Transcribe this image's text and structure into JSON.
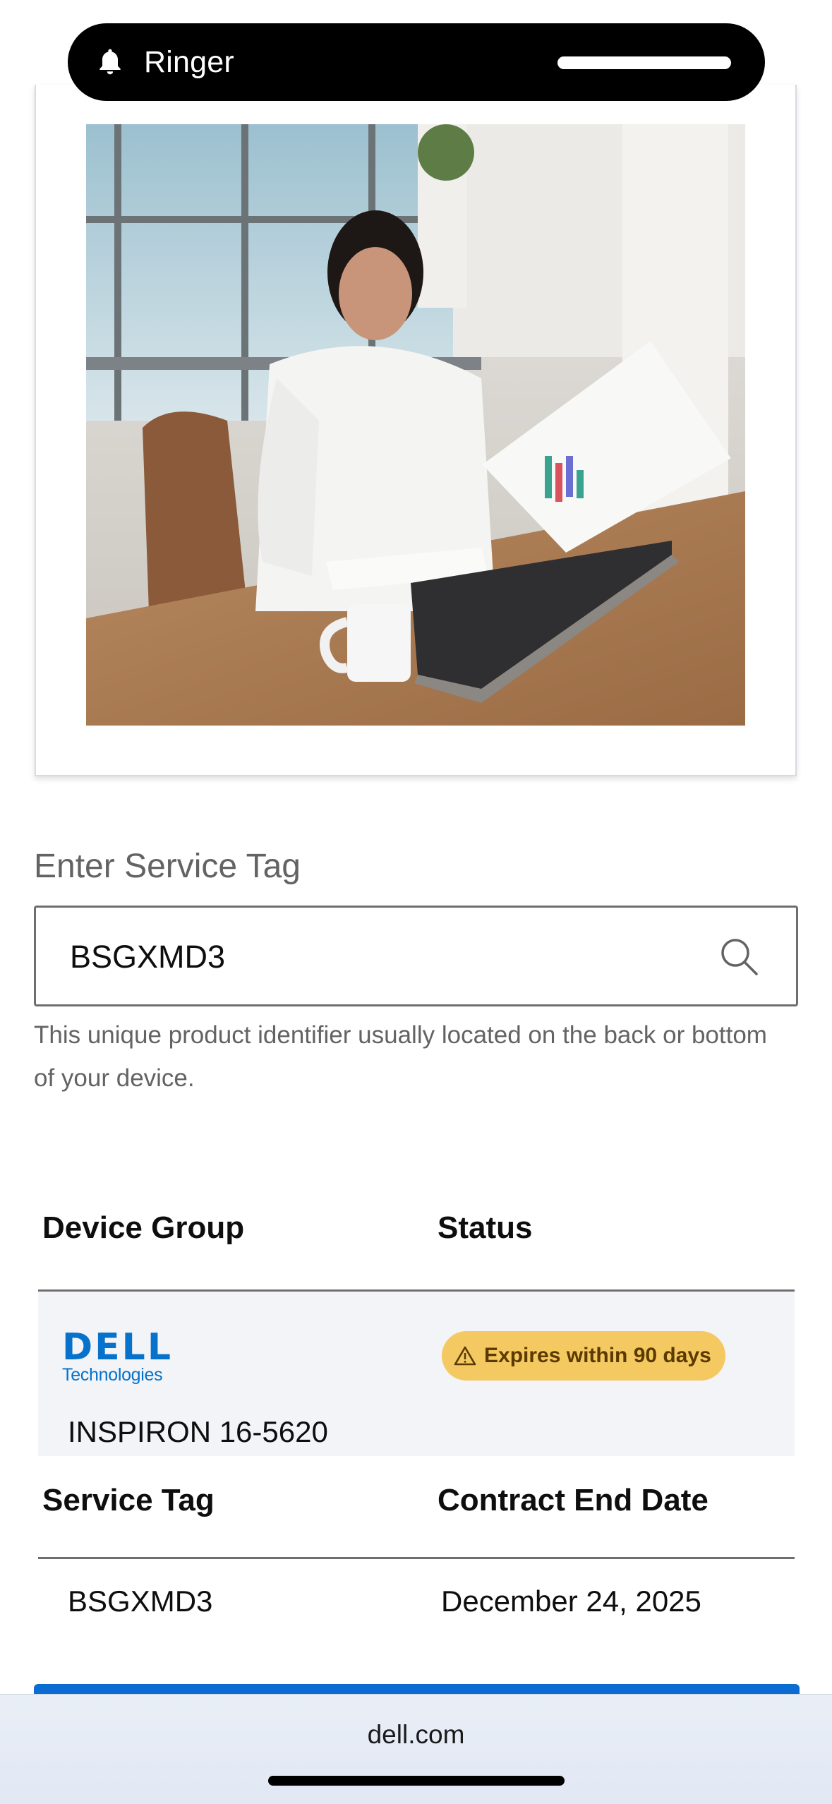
{
  "status_pill": {
    "label": "Ringer"
  },
  "service_tag": {
    "title": "Enter Service Tag",
    "value": "BSGXMD3",
    "helper": "This unique product identifier usually located on the back or bottom of your device."
  },
  "table": {
    "header1": {
      "col1": "Device Group",
      "col2": "Status"
    },
    "row1": {
      "logo_line1": "DELL",
      "logo_line2": "Technologies",
      "product": "INSPIRON 16-5620",
      "status_badge": "Expires within 90 days"
    },
    "header2": {
      "col1": "Service Tag",
      "col2": "Contract End Date"
    },
    "row2": {
      "service_tag": "BSGXMD3",
      "end_date": "December 24, 2025"
    }
  },
  "browser": {
    "url": "dell.com"
  },
  "colors": {
    "accent": "#0672cb",
    "badge": "#f4c961",
    "button": "#0b6cd1"
  },
  "icons": [
    "bell-icon",
    "search-icon",
    "warning-icon"
  ]
}
